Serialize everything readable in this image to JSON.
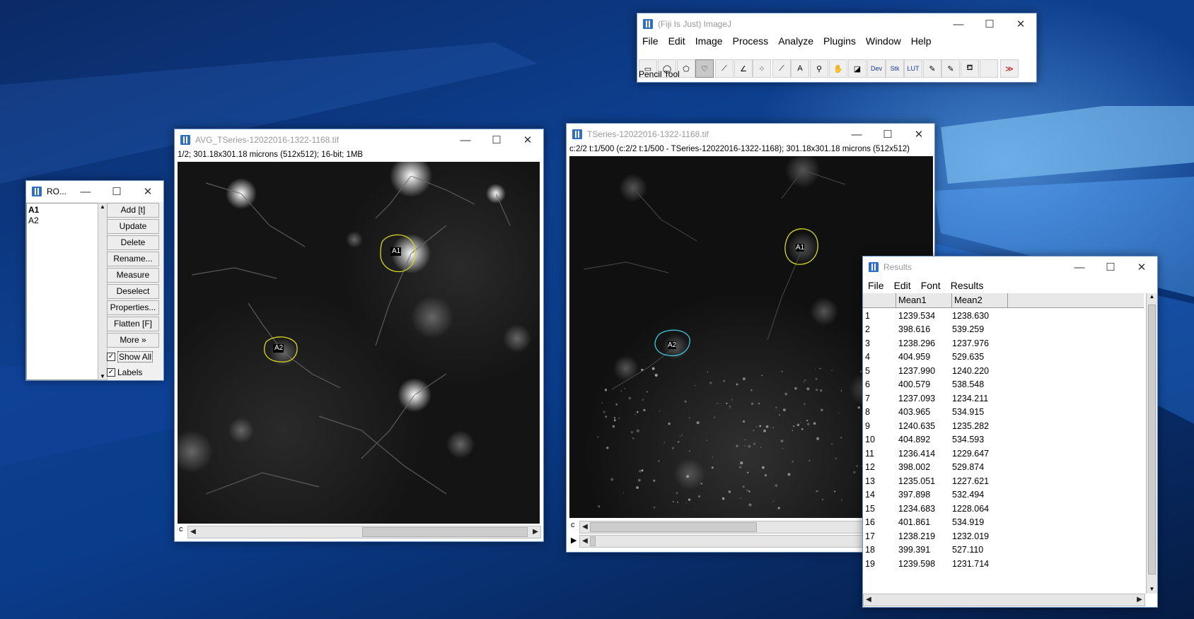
{
  "imagej": {
    "title": "(Fiji Is Just) ImageJ",
    "menu": [
      "File",
      "Edit",
      "Image",
      "Process",
      "Analyze",
      "Plugins",
      "Window",
      "Help"
    ],
    "tools": [
      {
        "name": "rectangle-tool-icon",
        "glyph": "▭"
      },
      {
        "name": "oval-tool-icon",
        "glyph": "◯"
      },
      {
        "name": "polygon-tool-icon",
        "glyph": "⬠"
      },
      {
        "name": "freehand-tool-icon",
        "glyph": "♡"
      },
      {
        "name": "line-tool-icon",
        "glyph": "⟋"
      },
      {
        "name": "angle-tool-icon",
        "glyph": "∠"
      },
      {
        "name": "multipoint-tool-icon",
        "glyph": "⁘"
      },
      {
        "name": "wand-tool-icon",
        "glyph": "⟋"
      },
      {
        "name": "text-tool-icon",
        "glyph": "A"
      },
      {
        "name": "magnifier-tool-icon",
        "glyph": "⚲"
      },
      {
        "name": "hand-tool-icon",
        "glyph": "✋"
      },
      {
        "name": "color-picker-tool-icon",
        "glyph": "◪"
      },
      {
        "name": "dev-tool-icon",
        "glyph": "Dev"
      },
      {
        "name": "stk-tool-icon",
        "glyph": "Stk"
      },
      {
        "name": "lut-tool-icon",
        "glyph": "LUT"
      },
      {
        "name": "pencil-tool-icon",
        "glyph": "✎"
      },
      {
        "name": "brush-tool-icon",
        "glyph": "✎"
      },
      {
        "name": "flood-fill-tool-icon",
        "glyph": "⛾"
      },
      {
        "name": "empty-tool-slot",
        "glyph": ""
      },
      {
        "name": "more-tools-icon",
        "glyph": "≫"
      }
    ],
    "status": "Pencil Tool"
  },
  "roi_manager": {
    "title": "RO...",
    "items": [
      "A1",
      "A2"
    ],
    "buttons": {
      "add": "Add [t]",
      "update": "Update",
      "delete": "Delete",
      "rename": "Rename...",
      "measure": "Measure",
      "deselect": "Deselect",
      "properties": "Properties...",
      "flatten": "Flatten [F]",
      "more": "More »"
    },
    "show_all": "Show All",
    "labels": "Labels"
  },
  "avg_window": {
    "title": "AVG_TSeries-12022016-1322-1168.tif",
    "info": "1/2; 301.18x301.18 microns (512x512); 16-bit; 1MB",
    "channel_label": "c",
    "roi_labels": [
      "A1",
      "A2"
    ]
  },
  "tseries_window": {
    "title": "TSeries-12022016-1322-1168.tif",
    "info": "c:2/2 t:1/500 (c:2/2  t:1/500 - TSeries-12022016-1322-1168); 301.18x301.18 microns (512x512)",
    "channel_label": "c",
    "roi_labels": [
      "A1",
      "A2"
    ]
  },
  "results": {
    "title": "Results",
    "menu": [
      "File",
      "Edit",
      "Font",
      "Results"
    ],
    "columns": [
      "",
      "Mean1",
      "Mean2"
    ],
    "rows": [
      [
        "1",
        "1239.534",
        "1238.630"
      ],
      [
        "2",
        "398.616",
        "539.259"
      ],
      [
        "3",
        "1238.296",
        "1237.976"
      ],
      [
        "4",
        "404.959",
        "529.635"
      ],
      [
        "5",
        "1237.990",
        "1240.220"
      ],
      [
        "6",
        "400.579",
        "538.548"
      ],
      [
        "7",
        "1237.093",
        "1234.211"
      ],
      [
        "8",
        "403.965",
        "534.915"
      ],
      [
        "9",
        "1240.635",
        "1235.282"
      ],
      [
        "10",
        "404.892",
        "534.593"
      ],
      [
        "11",
        "1236.414",
        "1229.647"
      ],
      [
        "12",
        "398.002",
        "529.874"
      ],
      [
        "13",
        "1235.051",
        "1227.621"
      ],
      [
        "14",
        "397.898",
        "532.494"
      ],
      [
        "15",
        "1234.683",
        "1228.064"
      ],
      [
        "16",
        "401.861",
        "534.919"
      ],
      [
        "17",
        "1238.219",
        "1232.019"
      ],
      [
        "18",
        "399.391",
        "527.110"
      ],
      [
        "19",
        "1239.598",
        "1231.714"
      ]
    ]
  },
  "colors": {
    "roi_yellow": "#d8d820",
    "roi_cyan": "#38c8d8",
    "desktop": "#0d3f8f"
  }
}
